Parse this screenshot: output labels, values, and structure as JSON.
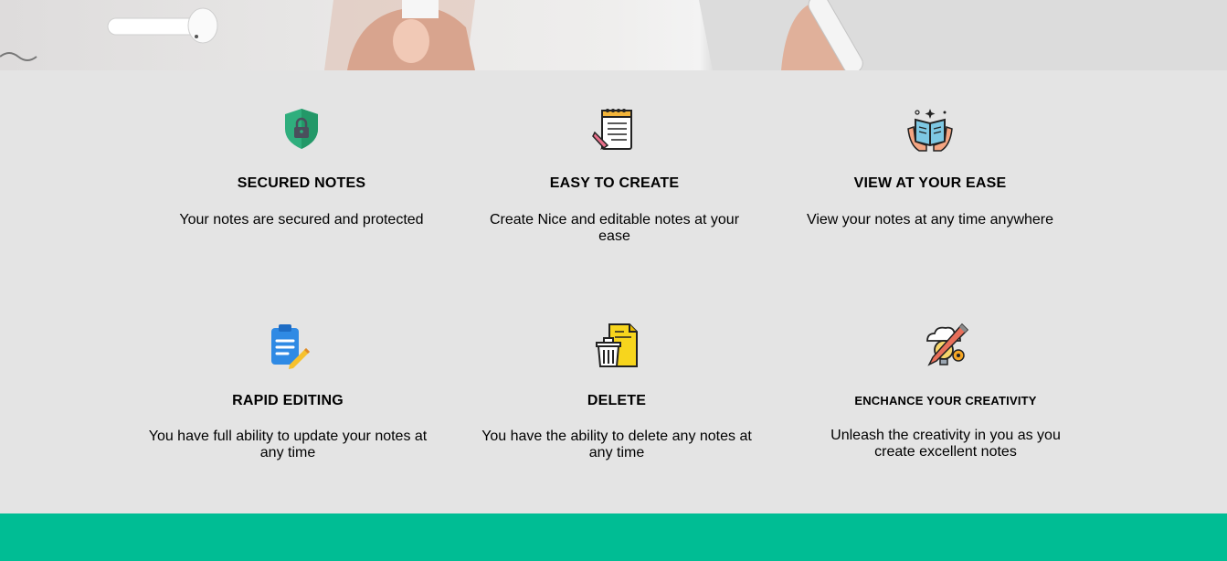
{
  "hero": {
    "image": "desk-photo-earbuds-coffee-pen"
  },
  "features": [
    {
      "title": "SECURED NOTES",
      "desc": "Your notes are secured and protected",
      "icon": "shield-lock-icon"
    },
    {
      "title": "EASY TO CREATE",
      "desc": "Create Nice and editable notes at your ease",
      "icon": "notepad-pencil-icon"
    },
    {
      "title": "VIEW AT YOUR EASE",
      "desc": "View your notes at any time anywhere",
      "icon": "open-book-hands-icon"
    },
    {
      "title": "RAPID EDITING",
      "desc": "You have full ability to update your notes at any time",
      "icon": "clipboard-pen-icon"
    },
    {
      "title": "DELETE",
      "desc": "You have the ability to delete any notes at any time",
      "icon": "trash-document-icon"
    },
    {
      "title": "ENCHANCE YOUR CREATIVITY",
      "desc": "Unleash the creativity in you as you create excellent notes",
      "icon": "creativity-bulb-gear-icon"
    }
  ],
  "colors": {
    "background": "#e4e4e4",
    "footer_band": "#00bd94"
  }
}
